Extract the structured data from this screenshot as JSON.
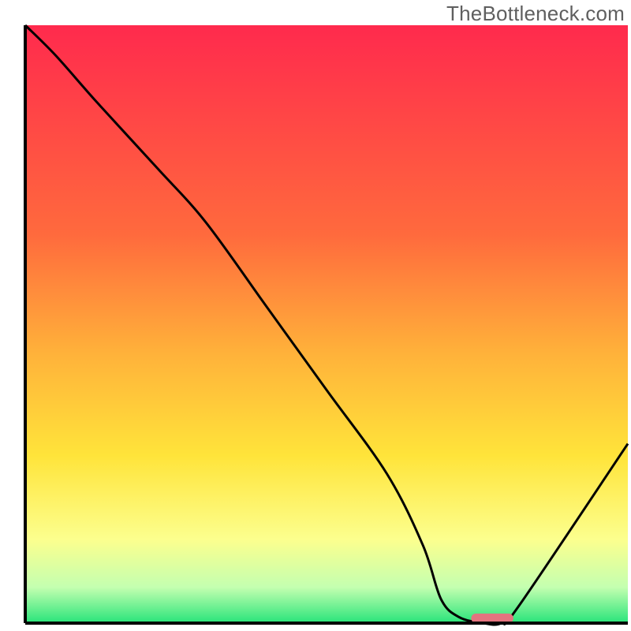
{
  "watermark": "TheBottleneck.com",
  "chart_data": {
    "type": "line",
    "title": "",
    "xlabel": "",
    "ylabel": "",
    "xlim": [
      0,
      100
    ],
    "ylim": [
      0,
      100
    ],
    "background_gradient_stops": [
      {
        "offset": 0,
        "color": "#ff2a4d"
      },
      {
        "offset": 35,
        "color": "#ff6a3d"
      },
      {
        "offset": 55,
        "color": "#ffb23a"
      },
      {
        "offset": 72,
        "color": "#ffe43a"
      },
      {
        "offset": 86,
        "color": "#fcff8e"
      },
      {
        "offset": 94,
        "color": "#c4ffb0"
      },
      {
        "offset": 100,
        "color": "#28e47a"
      }
    ],
    "series": [
      {
        "name": "bottleneck-curve",
        "x": [
          0,
          5,
          12,
          22,
          30,
          40,
          50,
          60,
          66,
          69,
          72,
          76,
          79,
          82,
          100
        ],
        "y": [
          100,
          95,
          87,
          76,
          67,
          53,
          39,
          25,
          13,
          4,
          1,
          0,
          0,
          3,
          30
        ]
      }
    ],
    "marker": {
      "name": "optimal-range",
      "x_center": 77.5,
      "y": 0.8,
      "width": 7,
      "height": 1.6,
      "color": "#e4747f"
    },
    "axes_color": "#000000",
    "curve_color": "#000000",
    "inner_box": {
      "x0": 32,
      "y0": 32,
      "x1": 796,
      "y1": 790
    }
  }
}
